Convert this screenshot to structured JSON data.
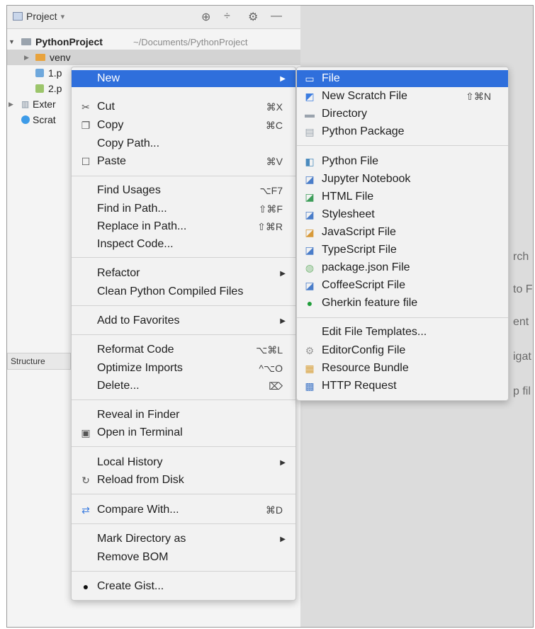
{
  "project_panel": {
    "title": "Project",
    "title_arrow": "▾",
    "root_name": "PythonProject",
    "root_path": "~/Documents/PythonProject",
    "items": [
      {
        "label": "venv",
        "icon": "folder-icon"
      },
      {
        "label": "1.p",
        "icon": "python-file-icon"
      },
      {
        "label": "2.p",
        "icon": "python-file-icon"
      },
      {
        "label": "Exter",
        "icon": "library-icon"
      },
      {
        "label": "Scrat",
        "icon": "scratch-icon"
      }
    ],
    "structure_tab": "Structure"
  },
  "hints": [
    "rch",
    "to Fi",
    "ent",
    "igat",
    "p fil"
  ],
  "context_menu": {
    "items": [
      {
        "label": "New",
        "shortcut": "",
        "submenu": true
      },
      {
        "label": "Cut",
        "shortcut": "⌘X",
        "icon": "scissors-icon"
      },
      {
        "label": "Copy",
        "shortcut": "⌘C",
        "icon": "copy-icon"
      },
      {
        "label": "Copy Path...",
        "shortcut": ""
      },
      {
        "label": "Paste",
        "shortcut": "⌘V",
        "icon": "paste-icon"
      },
      {
        "label": "Find Usages",
        "shortcut": "⌥F7"
      },
      {
        "label": "Find in Path...",
        "shortcut": "⇧⌘F"
      },
      {
        "label": "Replace in Path...",
        "shortcut": "⇧⌘R"
      },
      {
        "label": "Inspect Code...",
        "shortcut": ""
      },
      {
        "label": "Refactor",
        "shortcut": "",
        "submenu": true
      },
      {
        "label": "Clean Python Compiled Files",
        "shortcut": ""
      },
      {
        "label": "Add to Favorites",
        "shortcut": "",
        "submenu": true
      },
      {
        "label": "Reformat Code",
        "shortcut": "⌥⌘L"
      },
      {
        "label": "Optimize Imports",
        "shortcut": "^⌥O"
      },
      {
        "label": "Delete...",
        "shortcut": "⌦"
      },
      {
        "label": "Reveal in Finder",
        "shortcut": ""
      },
      {
        "label": "Open in Terminal",
        "shortcut": "",
        "icon": "terminal-icon"
      },
      {
        "label": "Local History",
        "shortcut": "",
        "submenu": true
      },
      {
        "label": "Reload from Disk",
        "shortcut": "",
        "icon": "reload-icon"
      },
      {
        "label": "Compare With...",
        "shortcut": "⌘D",
        "icon": "compare-icon"
      },
      {
        "label": "Mark Directory as",
        "shortcut": "",
        "submenu": true
      },
      {
        "label": "Remove BOM",
        "shortcut": ""
      },
      {
        "label": "Create Gist...",
        "shortcut": "",
        "icon": "github-icon"
      }
    ]
  },
  "new_submenu": {
    "items": [
      {
        "label": "File",
        "shortcut": "",
        "icon": "file-icon"
      },
      {
        "label": "New Scratch File",
        "shortcut": "⇧⌘N",
        "icon": "scratch-file-icon"
      },
      {
        "label": "Directory",
        "shortcut": "",
        "icon": "directory-icon"
      },
      {
        "label": "Python Package",
        "shortcut": "",
        "icon": "package-icon"
      },
      {
        "label": "Python File",
        "shortcut": "",
        "icon": "python-icon"
      },
      {
        "label": "Jupyter Notebook",
        "shortcut": "",
        "icon": "jupyter-icon"
      },
      {
        "label": "HTML File",
        "shortcut": "",
        "icon": "html-icon"
      },
      {
        "label": "Stylesheet",
        "shortcut": "",
        "icon": "css-icon"
      },
      {
        "label": "JavaScript File",
        "shortcut": "",
        "icon": "javascript-icon"
      },
      {
        "label": "TypeScript File",
        "shortcut": "",
        "icon": "typescript-icon"
      },
      {
        "label": "package.json File",
        "shortcut": "",
        "icon": "npm-icon"
      },
      {
        "label": "CoffeeScript File",
        "shortcut": "",
        "icon": "coffeescript-icon"
      },
      {
        "label": "Gherkin feature file",
        "shortcut": "",
        "icon": "gherkin-icon"
      },
      {
        "label": "Edit File Templates...",
        "shortcut": ""
      },
      {
        "label": "EditorConfig File",
        "shortcut": "",
        "icon": "editorconfig-icon"
      },
      {
        "label": "Resource Bundle",
        "shortcut": "",
        "icon": "resource-bundle-icon"
      },
      {
        "label": "HTTP Request",
        "shortcut": "",
        "icon": "http-request-icon"
      }
    ]
  },
  "colors": {
    "highlight": "#2f6fdc",
    "folder": "#e8a33d",
    "menu_bg": "#f2f2f2"
  }
}
